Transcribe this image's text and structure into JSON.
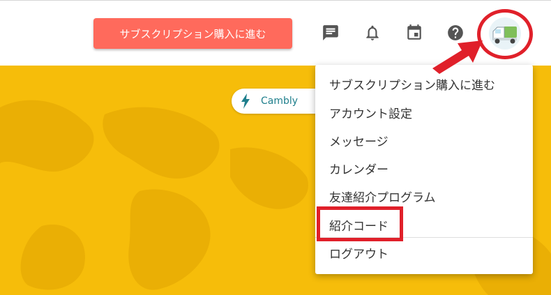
{
  "header": {
    "subscribe_label": "サブスクリプション購入に進む",
    "icons": [
      "chat-icon",
      "bell-icon",
      "calendar-icon",
      "help-icon"
    ]
  },
  "banner": {
    "text": "Cambly"
  },
  "menu": {
    "items": [
      {
        "label": "サブスクリプション購入に進む"
      },
      {
        "label": "アカウント設定"
      },
      {
        "label": "メッセージ"
      },
      {
        "label": "カレンダー"
      },
      {
        "label": "友達紹介プログラム"
      },
      {
        "label": "紹介コード"
      },
      {
        "label": "ログアウト"
      }
    ]
  },
  "colors": {
    "accent_button": "#ff6a5c",
    "hero_background": "#f6bd0a",
    "annotation": "#e0202a",
    "banner_text": "#1f7f8c"
  }
}
